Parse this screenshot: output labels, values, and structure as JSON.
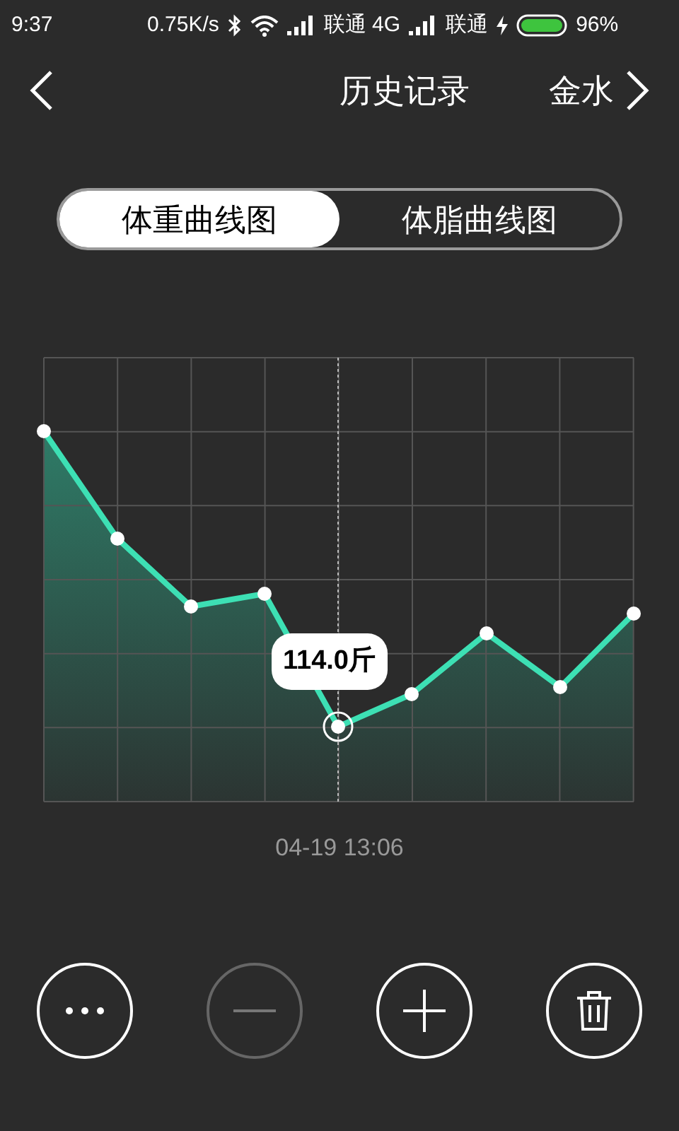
{
  "status_bar": {
    "time": "9:37",
    "speed": "0.75K/s",
    "carrier_1": "联通 4G",
    "carrier_2": "联通",
    "charging": true,
    "battery": "96%"
  },
  "header": {
    "title": "历史记录",
    "user": "金水"
  },
  "tabs": [
    {
      "label": "体重曲线图",
      "selected": true
    },
    {
      "label": "体脂曲线图",
      "selected": false
    }
  ],
  "chart": {
    "tooltip": "114.0斤",
    "date": "04-19 13:06"
  },
  "buttons": [
    {
      "kind": "more",
      "disabled": false
    },
    {
      "kind": "minus",
      "disabled": true
    },
    {
      "kind": "plus",
      "disabled": false
    },
    {
      "kind": "delete",
      "disabled": false
    }
  ]
}
